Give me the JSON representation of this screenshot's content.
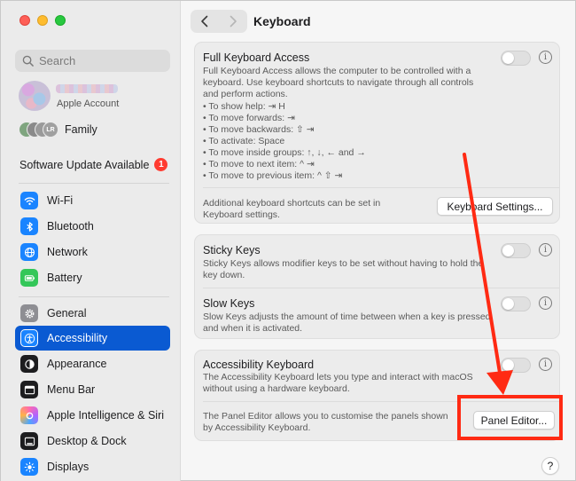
{
  "sidebar": {
    "search_placeholder": "Search",
    "account_label": "Apple Account",
    "family_label": "Family",
    "family_avatar_initials": [
      "",
      "",
      "",
      "LR"
    ],
    "software_update_label": "Software Update Available",
    "software_update_badge": "1",
    "items": [
      {
        "label": "Wi-Fi",
        "icon": "wifi-icon",
        "color": "#1a84ff"
      },
      {
        "label": "Bluetooth",
        "icon": "bluetooth-icon",
        "color": "#1a84ff"
      },
      {
        "label": "Network",
        "icon": "globe-icon",
        "color": "#1a84ff"
      },
      {
        "label": "Battery",
        "icon": "battery-icon",
        "color": "#34c759"
      },
      {
        "label": "General",
        "icon": "gear-icon",
        "color": "#8e8e93"
      },
      {
        "label": "Accessibility",
        "icon": "accessibility-icon",
        "color": "#1a84ff",
        "active": true
      },
      {
        "label": "Appearance",
        "icon": "appearance-icon",
        "color": "#1d1d1f"
      },
      {
        "label": "Menu Bar",
        "icon": "menu-bar-icon",
        "color": "#1d1d1f"
      },
      {
        "label": "Apple Intelligence & Siri",
        "icon": "siri-icon",
        "color": "#b061ff"
      },
      {
        "label": "Desktop & Dock",
        "icon": "dock-icon",
        "color": "#1d1d1f"
      },
      {
        "label": "Displays",
        "icon": "sun-icon",
        "color": "#1a84ff"
      }
    ]
  },
  "header": {
    "title": "Keyboard"
  },
  "full_keyboard_access": {
    "title": "Full Keyboard Access",
    "description": "Full Keyboard Access allows the computer to be controlled with a keyboard. Use keyboard shortcuts to navigate through all controls and perform actions.",
    "shortcuts": [
      "• To show help: ⇥ H",
      "• To move forwards: ⇥",
      "• To move backwards: ⇧ ⇥",
      "• To activate: Space",
      "• To move inside groups: ↑, ↓, ← and →",
      "• To move to next item: ^ ⇥",
      "• To move to previous item: ^ ⇧ ⇥"
    ],
    "additional_text": "Additional keyboard shortcuts can be set in Keyboard settings.",
    "button_label": "Keyboard Settings...",
    "enabled": false
  },
  "sticky_keys": {
    "title": "Sticky Keys",
    "description": "Sticky Keys allows modifier keys to be set without having to hold the key down.",
    "enabled": false
  },
  "slow_keys": {
    "title": "Slow Keys",
    "description": "Slow Keys adjusts the amount of time between when a key is pressed and when it is activated.",
    "enabled": false
  },
  "accessibility_keyboard": {
    "title": "Accessibility Keyboard",
    "description": "The Accessibility Keyboard lets you type and interact with macOS without using a hardware keyboard.",
    "panel_text": "The Panel Editor allows you to customise the panels shown by Accessibility Keyboard.",
    "button_label": "Panel Editor...",
    "enabled": false
  },
  "help_label": "?",
  "info_glyph": "i",
  "annotation": {
    "arrow_color": "#ff2a13",
    "highlight_color": "#ff2a13"
  }
}
